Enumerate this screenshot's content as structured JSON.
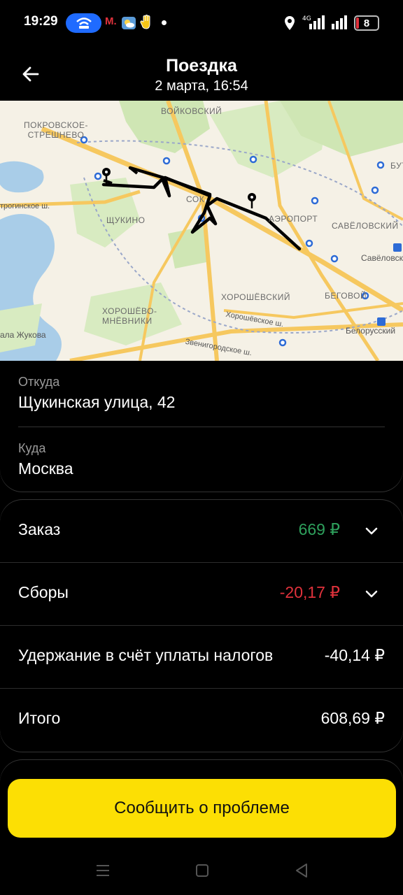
{
  "status_bar": {
    "time": "19:29",
    "metro_label": "М.",
    "battery": "8",
    "network": "4G",
    "icons": [
      "wifi-hotspot-icon",
      "metro-icon",
      "weather-icon",
      "hand-icon",
      "location-icon",
      "signal-icon",
      "signal-icon",
      "battery-icon"
    ]
  },
  "header": {
    "title": "Поездка",
    "subtitle": "2 марта, 16:54",
    "back_icon": "arrow-left-icon"
  },
  "map": {
    "labels": {
      "voykovsky": "ВОЙКОВСКИЙ",
      "pokrovskoe": "ПОКРОВСКОЕ-\nСТРЕШНЕВО",
      "butyrsky": "БУТЫР",
      "stroginskoe": "трогинское ш.",
      "sokol": "СОК",
      "aeroport": "АЭРОПОРТ",
      "savelovsky": "САВЁЛОВСКИЙ",
      "shchukino": "ЩУКИНО",
      "savelovsky_station": "Савёловский",
      "khoroshevsky": "ХОРОШЁВСКИЙ",
      "begovoy": "БЕГОВОЙ",
      "khoroshevo": "ХОРОШЁВО-\nМНЁВНИКИ",
      "khoroshevskoe": "Хорошёвское ш.",
      "belorussky": "Белорусский",
      "zhukova": "ала Жукова",
      "zvenigorodskoe": "Звенигородское ш."
    },
    "colors": {
      "water": "#a9cde8",
      "park": "#cfe6b4",
      "road": "#f6c85f",
      "background": "#f5f1e6",
      "route": "#000000"
    }
  },
  "trip": {
    "from_label": "Откуда",
    "from_value": "Щукинская улица, 42",
    "to_label": "Куда",
    "to_value": "Москва"
  },
  "summary": {
    "order": {
      "label": "Заказ",
      "value": "669 ₽",
      "color": "#2ea05c"
    },
    "fees": {
      "label": "Сборы",
      "value": "-20,17 ₽",
      "color": "#e0323c"
    },
    "tax": {
      "label": "Удержание в счёт уплаты налогов",
      "value": "-40,14 ₽"
    },
    "total": {
      "label": "Итого",
      "value": "608,69 ₽"
    }
  },
  "report_button": {
    "label": "Сообщить о проблеме",
    "color": "#fcdf04"
  },
  "nav": {
    "icons": [
      "menu-icon",
      "home-icon",
      "back-icon"
    ]
  }
}
